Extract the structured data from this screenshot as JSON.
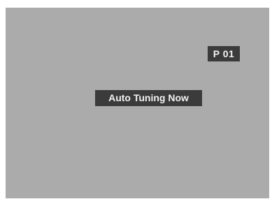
{
  "osd": {
    "channel": "P 01",
    "status": "Auto Tuning Now"
  },
  "colors": {
    "screen_background": "#ababab",
    "label_background": "#3b3b3b",
    "label_text": "#f2f2f2"
  }
}
